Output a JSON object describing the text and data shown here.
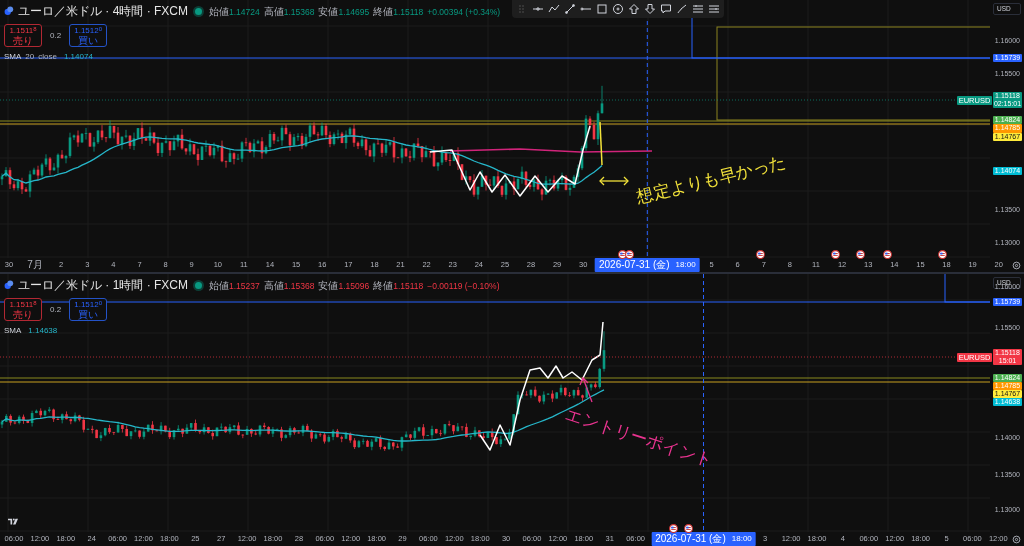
{
  "panes": [
    {
      "symbol_title": "ユーロ／米ドル · 4時間 · FXCM",
      "market_open": true,
      "rising": true,
      "ohlc": [
        {
          "label": "始値",
          "value": "1.14724"
        },
        {
          "label": "高値",
          "value": "1.15368"
        },
        {
          "label": "安値",
          "value": "1.14695"
        },
        {
          "label": "終値",
          "value": "1.15118"
        }
      ],
      "change": "+0.00394 (+0.34%)",
      "sell": {
        "price": "1.1511$^{8}$",
        "label": "売り"
      },
      "spread": "0.2",
      "buy": {
        "price": "1.1512$^{0}$",
        "label": "買い"
      },
      "indicator": {
        "name": "SMA",
        "params": [
          "20",
          "close"
        ],
        "value": "1.14074"
      },
      "currency": "USD",
      "price_labels": [
        "1.16000",
        "1.15500",
        "1.13500",
        "1.13000"
      ],
      "price_tags": [
        {
          "text": "1.15739",
          "color": "#2962ff"
        },
        {
          "symbol": "EURUSD",
          "text": "1.15118",
          "countdown": "02:15:01",
          "color": "#089981"
        },
        {
          "text": "1.14824",
          "color": "#4caf50"
        },
        {
          "text": "1.14785",
          "color": "#ff9800"
        },
        {
          "text": "1.14767",
          "color": "#ffeb3b"
        },
        {
          "text": "1.14074",
          "color": "#00bcd4"
        }
      ],
      "time_labels": [
        {
          "kind": "tick",
          "text": "30"
        },
        {
          "kind": "tick",
          "text": "7月"
        },
        {
          "kind": "tick",
          "text": "2"
        },
        {
          "kind": "tick",
          "text": "3"
        },
        {
          "kind": "tick",
          "text": "4"
        },
        {
          "kind": "tick",
          "text": "7"
        },
        {
          "kind": "tick",
          "text": "8"
        },
        {
          "kind": "tick",
          "text": "9"
        },
        {
          "kind": "tick",
          "text": "10"
        },
        {
          "kind": "tick",
          "text": "11"
        },
        {
          "kind": "tick",
          "text": "14"
        },
        {
          "kind": "tick",
          "text": "15"
        },
        {
          "kind": "tick",
          "text": "16"
        },
        {
          "kind": "tick",
          "text": "17"
        },
        {
          "kind": "tick",
          "text": "18"
        },
        {
          "kind": "tick",
          "text": "21"
        },
        {
          "kind": "tick",
          "text": "22"
        },
        {
          "kind": "tick",
          "text": "23"
        },
        {
          "kind": "tick",
          "text": "24"
        },
        {
          "kind": "tick",
          "text": "25"
        },
        {
          "kind": "tick",
          "text": "28"
        },
        {
          "kind": "tick",
          "text": "29"
        },
        {
          "kind": "tick",
          "text": "30"
        },
        {
          "kind": "cursor",
          "date": "2026-07-31 (金)",
          "time": "18:00"
        },
        {
          "kind": "tick",
          "text": "5"
        },
        {
          "kind": "tick",
          "text": "6"
        },
        {
          "kind": "tick",
          "text": "7"
        },
        {
          "kind": "tick",
          "text": "8"
        },
        {
          "kind": "tick",
          "text": "11"
        },
        {
          "kind": "tick",
          "text": "12"
        },
        {
          "kind": "tick",
          "text": "13"
        },
        {
          "kind": "tick",
          "text": "14"
        },
        {
          "kind": "tick",
          "text": "15"
        },
        {
          "kind": "tick",
          "text": "18"
        },
        {
          "kind": "tick",
          "text": "19"
        },
        {
          "kind": "tick",
          "text": "20"
        }
      ],
      "annotation": {
        "text": "想定よりも早かった",
        "color": "#f2e23a"
      }
    },
    {
      "symbol_title": "ユーロ／米ドル · 1時間 · FXCM",
      "market_open": true,
      "rising": false,
      "ohlc": [
        {
          "label": "始値",
          "value": "1.15237"
        },
        {
          "label": "高値",
          "value": "1.15368"
        },
        {
          "label": "安値",
          "value": "1.15096"
        },
        {
          "label": "終値",
          "value": "1.15118"
        }
      ],
      "change": "−0.00119 (−0.10%)",
      "sell": {
        "price": "1.1511$^{8}$",
        "label": "売り"
      },
      "spread": "0.2",
      "buy": {
        "price": "1.1512$^{0}$",
        "label": "買い"
      },
      "indicator": {
        "name": "SMA",
        "value": "1.14638"
      },
      "currency": "USD",
      "price_labels": [
        "1.16000",
        "1.15500",
        "1.14000",
        "1.13500",
        "1.13000"
      ],
      "price_tags": [
        {
          "text": "1.15739",
          "color": "#2962ff"
        },
        {
          "symbol": "EURUSD",
          "text": "1.15118",
          "countdown": "15:01",
          "color": "#f23645"
        },
        {
          "text": "1.14824",
          "color": "#4caf50"
        },
        {
          "text": "1.14785",
          "color": "#ff9800"
        },
        {
          "text": "1.14767",
          "color": "#ffeb3b"
        },
        {
          "text": "1.14638",
          "color": "#00bcd4"
        }
      ],
      "time_labels": [
        {
          "kind": "tick",
          "text": "06:00"
        },
        {
          "kind": "tick",
          "text": "12:00"
        },
        {
          "kind": "tick",
          "text": "18:00"
        },
        {
          "kind": "tick",
          "text": "24"
        },
        {
          "kind": "tick",
          "text": "06:00"
        },
        {
          "kind": "tick",
          "text": "12:00"
        },
        {
          "kind": "tick",
          "text": "18:00"
        },
        {
          "kind": "tick",
          "text": "25"
        },
        {
          "kind": "tick",
          "text": "27"
        },
        {
          "kind": "tick",
          "text": "12:00"
        },
        {
          "kind": "tick",
          "text": "18:00"
        },
        {
          "kind": "tick",
          "text": "28"
        },
        {
          "kind": "tick",
          "text": "06:00"
        },
        {
          "kind": "tick",
          "text": "12:00"
        },
        {
          "kind": "tick",
          "text": "18:00"
        },
        {
          "kind": "tick",
          "text": "29"
        },
        {
          "kind": "tick",
          "text": "06:00"
        },
        {
          "kind": "tick",
          "text": "12:00"
        },
        {
          "kind": "tick",
          "text": "18:00"
        },
        {
          "kind": "tick",
          "text": "30"
        },
        {
          "kind": "tick",
          "text": "06:00"
        },
        {
          "kind": "tick",
          "text": "12:00"
        },
        {
          "kind": "tick",
          "text": "18:00"
        },
        {
          "kind": "tick",
          "text": "31"
        },
        {
          "kind": "tick",
          "text": "06:00"
        },
        {
          "kind": "cursor",
          "date": "2026-07-31 (金)",
          "time": "18:00"
        },
        {
          "kind": "tick",
          "text": "3"
        },
        {
          "kind": "tick",
          "text": "12:00"
        },
        {
          "kind": "tick",
          "text": "18:00"
        },
        {
          "kind": "tick",
          "text": "4"
        },
        {
          "kind": "tick",
          "text": "06:00"
        },
        {
          "kind": "tick",
          "text": "12:00"
        },
        {
          "kind": "tick",
          "text": "18:00"
        },
        {
          "kind": "tick",
          "text": "5"
        },
        {
          "kind": "tick",
          "text": "06:00"
        },
        {
          "kind": "tick",
          "text": "12:00"
        }
      ],
      "annotation": {
        "text": "エントリーポイント",
        "color": "#e8338f"
      }
    }
  ]
}
